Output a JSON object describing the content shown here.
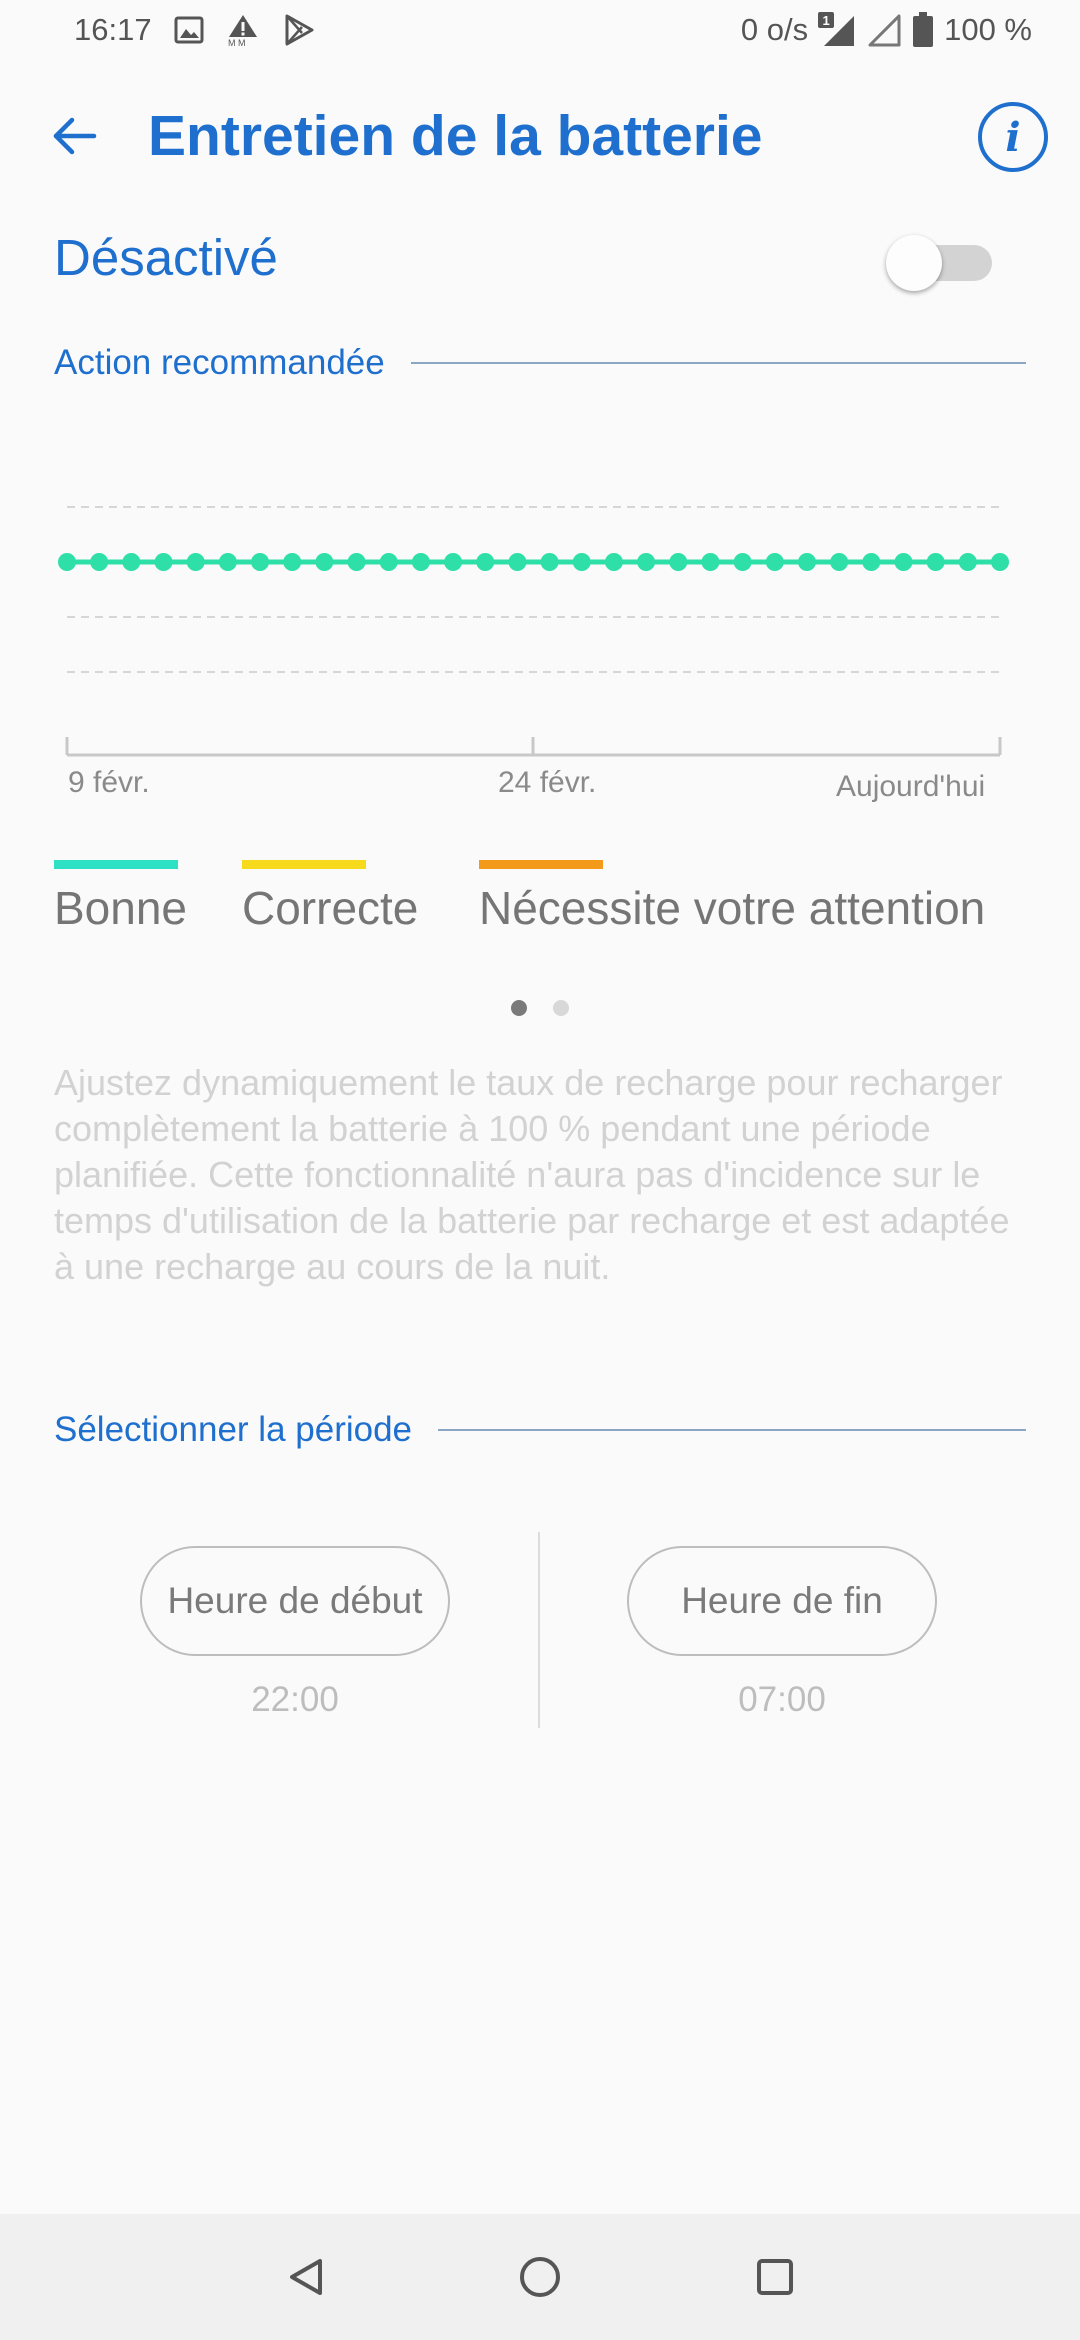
{
  "status_bar": {
    "time": "16:17",
    "network_speed": "0 o/s",
    "sim_badge": "1",
    "battery_percent": "100 %",
    "left_icons": [
      "image-icon",
      "warning-icon",
      "play-store-icon"
    ]
  },
  "header": {
    "title": "Entretien de la batterie",
    "back_icon": "arrow-left-icon",
    "info_glyph": "i"
  },
  "toggle": {
    "label": "Désactivé",
    "on": false
  },
  "section_recommended": {
    "label": "Action recommandée"
  },
  "chart_data": {
    "type": "scatter",
    "x_tick_labels": [
      "9 févr.",
      "24 févr.",
      "Aujourd'hui"
    ],
    "points_count": 30,
    "series": [
      {
        "status": "Bonne",
        "values": [
          1,
          1,
          1,
          1,
          1,
          1,
          1,
          1,
          1,
          1,
          1,
          1,
          1,
          1,
          1,
          1,
          1,
          1,
          1,
          1,
          1,
          1,
          1,
          1,
          1,
          1,
          1,
          1,
          1,
          1
        ]
      }
    ],
    "levels": [
      "Bonne",
      "Correcte",
      "Nécessite votre attention"
    ],
    "grid": true
  },
  "legend": [
    {
      "label": "Bonne",
      "color": "#2ee0c4"
    },
    {
      "label": "Correcte",
      "color": "#f7da1c"
    },
    {
      "label": "Nécessite votre attention",
      "color": "#f39a1b"
    }
  ],
  "pager": {
    "count": 2,
    "active": 0
  },
  "description": "Ajustez dynamiquement le taux de recharge pour recharger complètement la batterie à 100 % pendant une période planifiée. Cette fonctionnalité n'aura pas d'incidence sur le temps d'utilisation de la batterie par recharge et est adaptée à une recharge au cours de la nuit.",
  "section_period": {
    "label": "Sélectionner la période"
  },
  "period": {
    "start_label": "Heure de début",
    "start_time": "22:00",
    "end_label": "Heure de fin",
    "end_time": "07:00"
  },
  "colors": {
    "accent": "#1f6fce",
    "dot": "#2ee0a8",
    "point_outline": "#2ee0a8"
  },
  "nav_bar": {
    "icons": [
      "back-triangle-icon",
      "home-circle-icon",
      "recents-square-icon"
    ]
  }
}
